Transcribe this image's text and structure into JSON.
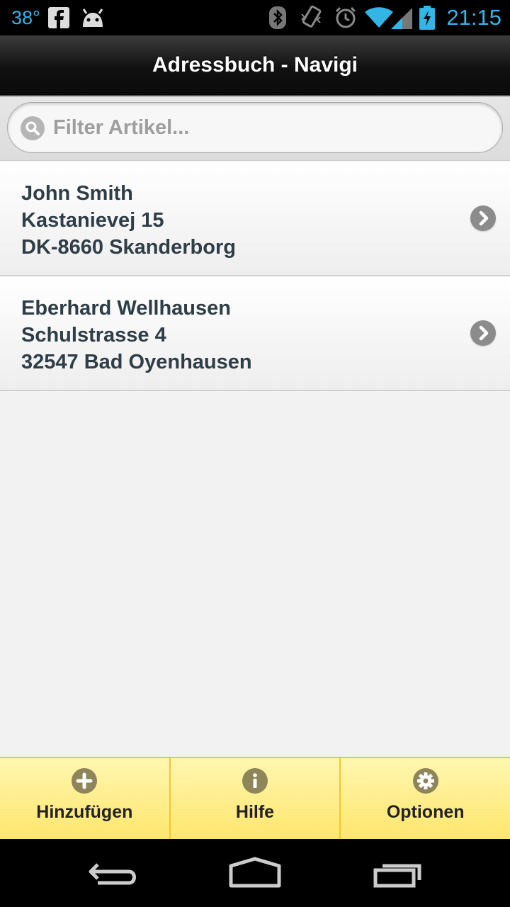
{
  "statusbar": {
    "temperature": "38°",
    "time": "21:15",
    "icons": [
      "facebook-icon",
      "android-icon",
      "bluetooth-icon",
      "vibrate-icon",
      "alarm-icon",
      "wifi-icon",
      "signal-icon",
      "battery-charging-icon"
    ]
  },
  "header": {
    "title": "Adressbuch - Navigi"
  },
  "filter": {
    "placeholder": "Filter Artikel...",
    "value": ""
  },
  "contacts": [
    {
      "name": "John Smith",
      "street": "Kastanievej 15",
      "city": "DK-8660 Skanderborg"
    },
    {
      "name": "Eberhard Wellhausen",
      "street": "Schulstrasse 4",
      "city": "32547 Bad Oyenhausen"
    }
  ],
  "footer": {
    "buttons": [
      {
        "label": "Hinzufügen",
        "icon": "plus-icon"
      },
      {
        "label": "Hilfe",
        "icon": "info-icon"
      },
      {
        "label": "Optionen",
        "icon": "gear-icon"
      }
    ]
  },
  "navbar": {
    "icons": [
      "back-icon",
      "home-icon",
      "recent-apps-icon"
    ]
  },
  "colors": {
    "accent": "#33b5e5",
    "footer": "#ffe56b",
    "text": "#2f3e46"
  }
}
